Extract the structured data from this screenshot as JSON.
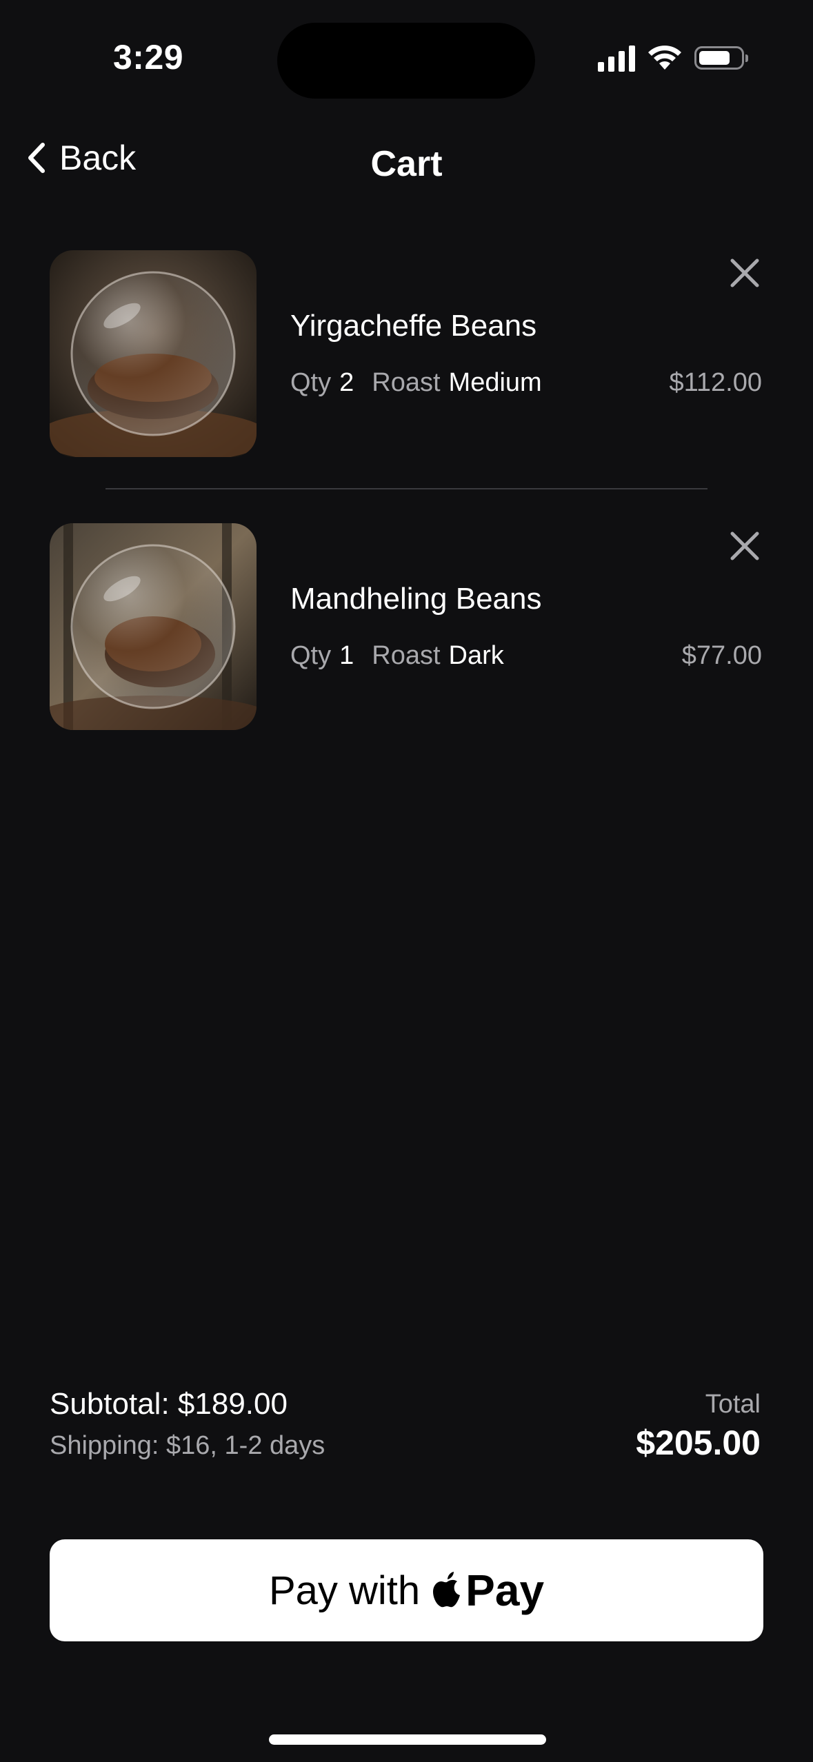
{
  "status_bar": {
    "time": "3:29"
  },
  "nav": {
    "back_label": "Back",
    "title": "Cart"
  },
  "cart": {
    "items": [
      {
        "name": "Yirgacheffe Beans",
        "qty_label": "Qty",
        "qty": "2",
        "roast_label": "Roast",
        "roast": "Medium",
        "price": "$112.00"
      },
      {
        "name": "Mandheling Beans",
        "qty_label": "Qty",
        "qty": "1",
        "roast_label": "Roast",
        "roast": "Dark",
        "price": "$77.00"
      }
    ]
  },
  "summary": {
    "subtotal": "Subtotal: $189.00",
    "shipping": "Shipping: $16, 1-2 days",
    "total_label": "Total",
    "total_value": "$205.00"
  },
  "pay_button": {
    "prefix": "Pay with",
    "brand": "Pay"
  },
  "colors": {
    "background": "#0f0f11",
    "muted_text": "#a9a9ad",
    "button_bg": "#ffffff"
  }
}
